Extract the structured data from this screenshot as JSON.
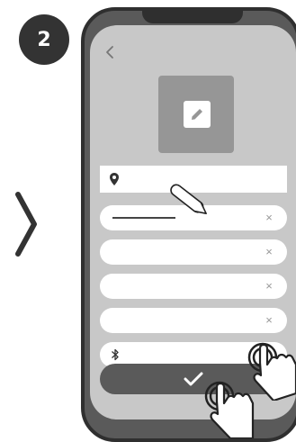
{
  "step": {
    "number": "2"
  },
  "icons": {
    "next": "chevron-right-icon",
    "back": "chevron-left-icon",
    "edit": "pencil-icon",
    "location": "map-pin-icon",
    "bluetooth": "bluetooth-icon",
    "clear": "×",
    "confirm": "checkmark-icon",
    "tap": "hand-tap-icon",
    "stylus": "stylus-icon"
  },
  "form": {
    "fields": [
      {
        "type": "location",
        "value": ""
      },
      {
        "type": "text",
        "value": "",
        "clear": "×"
      },
      {
        "type": "text",
        "value": "",
        "clear": "×"
      },
      {
        "type": "text",
        "value": "",
        "clear": "×"
      },
      {
        "type": "text",
        "value": "",
        "clear": "×"
      },
      {
        "type": "bluetooth",
        "value": ""
      }
    ]
  },
  "colors": {
    "badge": "#333333",
    "phone_frame": "#2f2f2f",
    "screen": "#c8c8c8",
    "button": "#5a5a5a"
  }
}
